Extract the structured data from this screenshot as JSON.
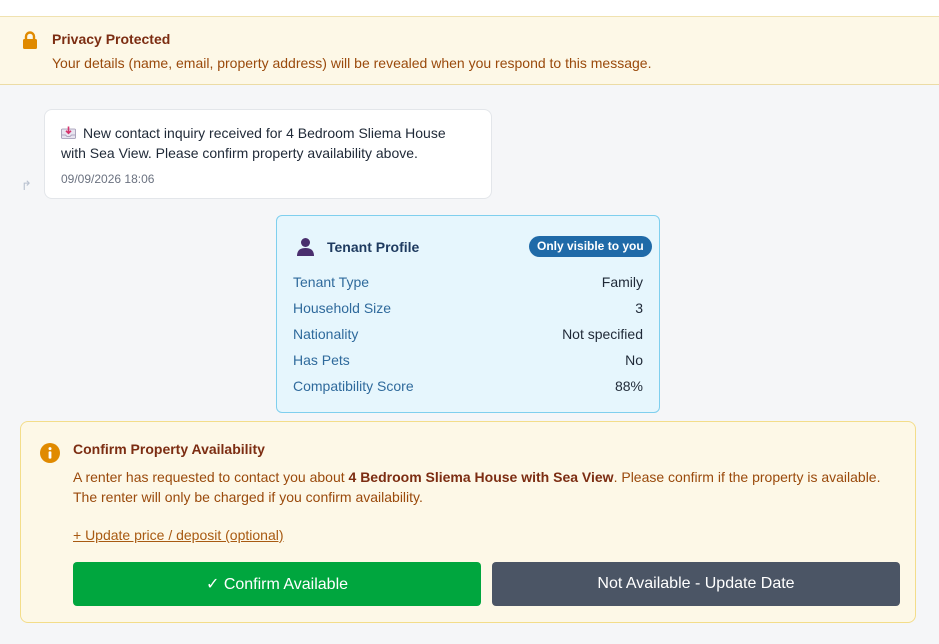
{
  "privacy": {
    "title": "Privacy Protected",
    "description": "Your details (name, email, property address) will be revealed when you respond to this message."
  },
  "message": {
    "text": "New contact inquiry received for 4 Bedroom Sliema House with Sea View. Please confirm property availability above.",
    "timestamp": "09/09/2026 18:06"
  },
  "tenant_profile": {
    "title": "Tenant Profile",
    "badge": "Only visible to you",
    "rows": [
      {
        "label": "Tenant Type",
        "value": "Family"
      },
      {
        "label": "Household Size",
        "value": "3"
      },
      {
        "label": "Nationality",
        "value": "Not specified"
      },
      {
        "label": "Has Pets",
        "value": "No"
      },
      {
        "label": "Compatibility Score",
        "value": "88%"
      }
    ]
  },
  "availability": {
    "title": "Confirm Property Availability",
    "desc_prefix": "A renter has requested to contact you about ",
    "property_name": "4 Bedroom Sliema House with Sea View",
    "desc_suffix": ". Please confirm if the property is available. The renter will only be charged if you confirm availability.",
    "update_link": "+ Update price / deposit (optional)",
    "confirm_button": "✓ Confirm Available",
    "not_available_button": "Not Available - Update Date"
  },
  "colors": {
    "accent_orange": "#e08a00",
    "confirm_green": "#00a63e",
    "secondary_gray": "#4b5565",
    "badge_blue": "#1f6aa8"
  }
}
